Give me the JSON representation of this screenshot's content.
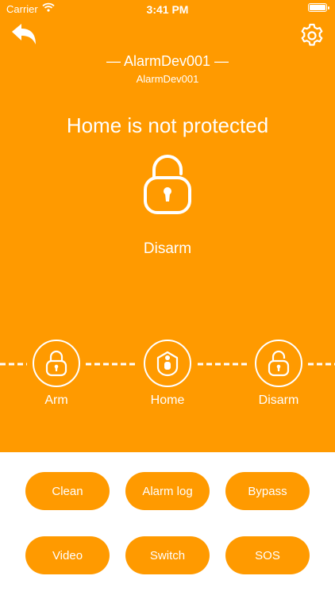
{
  "status_bar": {
    "carrier": "Carrier",
    "time": "3:41 PM"
  },
  "device": {
    "title": "— AlarmDev001 —",
    "subtitle": "AlarmDev001"
  },
  "headline": "Home is not protected",
  "current_status": "Disarm",
  "modes": [
    {
      "label": "Arm",
      "icon": "lock-closed-icon"
    },
    {
      "label": "Home",
      "icon": "home-shield-icon"
    },
    {
      "label": "Disarm",
      "icon": "lock-open-icon"
    }
  ],
  "actions": [
    "Clean",
    "Alarm log",
    "Bypass",
    "Video",
    "Switch",
    "SOS"
  ],
  "colors": {
    "accent": "#FF9A00",
    "foreground": "#FFFFFF"
  }
}
